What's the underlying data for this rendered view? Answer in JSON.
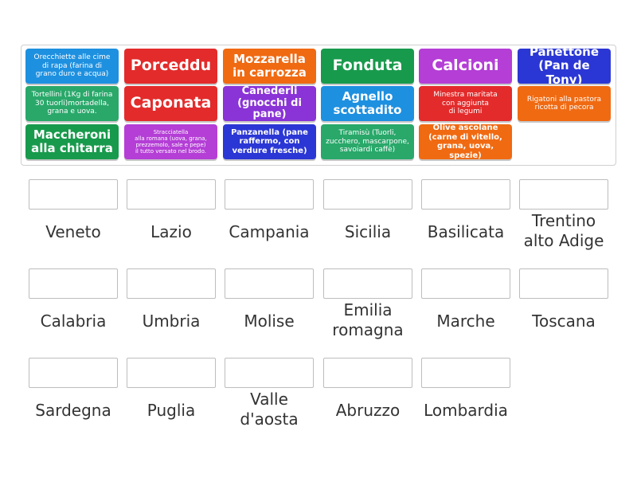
{
  "colors": {
    "blue": "#1e90e0",
    "red": "#e32b2b",
    "orange": "#f06a12",
    "green": "#189a4c",
    "violet": "#b43ed6",
    "indigo": "#2b37d4",
    "purple": "#8a33d6",
    "teal": "#29a86a"
  },
  "cards": [
    "Orecchiette alle cime\ndi rapa (farina di\ngrano duro e acqua)",
    "Porceddu",
    "Mozzarella\nin carrozza",
    "Fonduta",
    "Calcioni",
    "Panettone\n(Pan de Tony)",
    "Tortellini (1Kg di farina\n30 tuorli)mortadella,\ngrana e uova.",
    "Caponata",
    "Canederli\n(gnocchi di pane)",
    "Agnello\nscottadito",
    "Minestra maritata\ncon aggiunta\ndi legumi",
    "Rigatoni alla pastora\nricotta di pecora",
    "Maccheroni\nalla chitarra",
    "Stracciatella\nalla romana (uova, grana,\nprezzemolo, sale e pepe)\nil tutto versato nel brodo.",
    "Panzanella (pane\nraffermo, con\nverdure fresche)",
    "Tiramisù (Tuorli,\nzucchero, mascarpone,\nsavoiardi caffè)",
    "Olive ascolane\n(carne di vitello,\ngrana, uova, spezie)"
  ],
  "regions": [
    "Veneto",
    "Lazio",
    "Campania",
    "Sicilia",
    "Basilicata",
    "Trentino\nalto Adige",
    "Calabria",
    "Umbria",
    "Molise",
    "Emilia\nromagna",
    "Marche",
    "Toscana",
    "Sardegna",
    "Puglia",
    "Valle\nd'aosta",
    "Abruzzo",
    "Lombardia"
  ]
}
